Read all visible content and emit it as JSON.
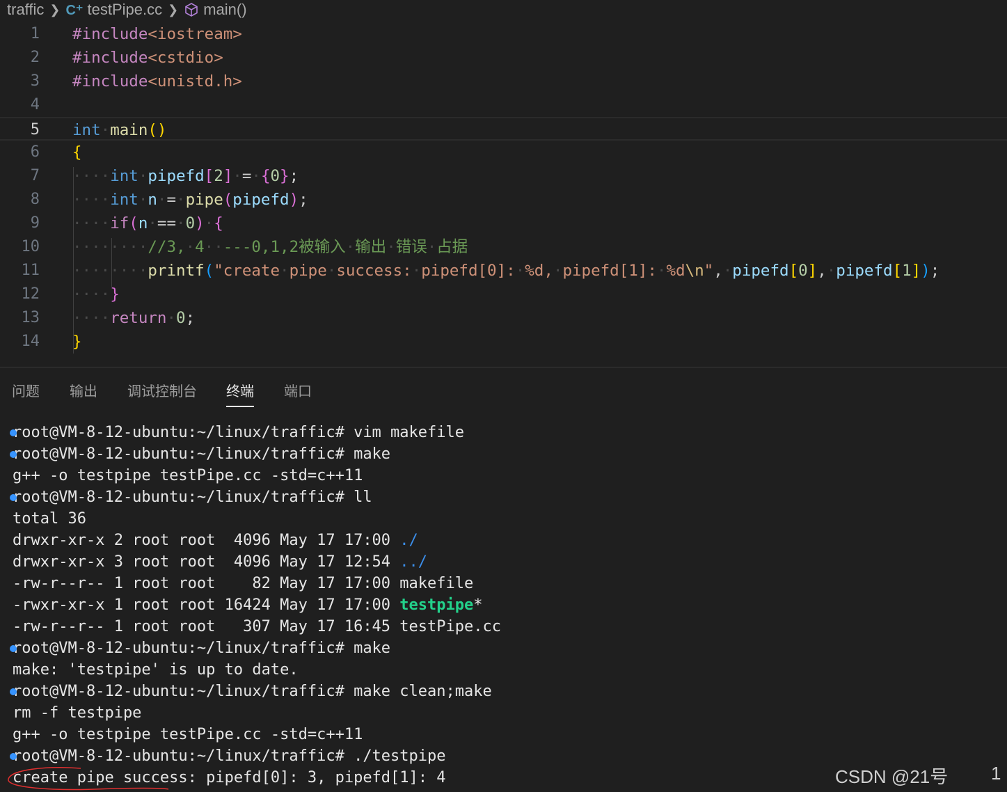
{
  "breadcrumb": {
    "folder": "traffic",
    "file": "testPipe.cc",
    "symbol": "main()",
    "file_icon": "cpp-icon",
    "symbol_icon": "cube-icon"
  },
  "editor": {
    "line_numbers": [
      "1",
      "2",
      "3",
      "4",
      "5",
      "6",
      "7",
      "8",
      "9",
      "10",
      "11",
      "12",
      "13",
      "14"
    ],
    "lines": [
      "#include<iostream>",
      "#include<cstdio>",
      "#include<unistd.h>",
      "",
      "int main()",
      "{",
      "    int pipefd[2] = {0};",
      "    int n = pipe(pipefd);",
      "    if(n == 0) {",
      "        //3, 4  ---0,1,2被输入 输出 错误 占据",
      "        printf(\"create pipe success: pipefd[0]: %d, pipefd[1]: %d\\n\", pipefd[0], pipefd[1]);",
      "    }",
      "    return 0;",
      "}"
    ]
  },
  "panel": {
    "tabs": [
      "问题",
      "输出",
      "调试控制台",
      "终端",
      "端口"
    ],
    "active_tab": "终端"
  },
  "terminal": {
    "lines": [
      "root@VM-8-12-ubuntu:~/linux/traffic# vim makefile",
      "root@VM-8-12-ubuntu:~/linux/traffic# make",
      "g++ -o testpipe testPipe.cc -std=c++11",
      "root@VM-8-12-ubuntu:~/linux/traffic# ll",
      "total 36",
      "drwxr-xr-x 2 root root  4096 May 17 17:00 ./",
      "drwxr-xr-x 3 root root  4096 May 17 12:54 ../",
      "-rw-r--r-- 1 root root    82 May 17 17:00 makefile",
      "-rwxr-xr-x 1 root root 16424 May 17 17:00 testpipe*",
      "-rw-r--r-- 1 root root   307 May 17 16:45 testPipe.cc",
      "root@VM-8-12-ubuntu:~/linux/traffic# make",
      "make: 'testpipe' is up to date.",
      "root@VM-8-12-ubuntu:~/linux/traffic# make clean;make",
      "rm -f testpipe",
      "g++ -o testpipe testPipe.cc -std=c++11",
      "root@VM-8-12-ubuntu:~/linux/traffic# ./testpipe",
      "create pipe success: pipefd[0]: 3, pipefd[1]: 4"
    ]
  },
  "watermark": "CSDN @21号",
  "edge_text": "1",
  "colors": {
    "background": "#1f1f1f",
    "keyword": "#569cd6",
    "string": "#ce9178",
    "comment": "#6a9955",
    "terminal_dir": "#3b8eea",
    "terminal_exe": "#23d18b",
    "prompt_dot": "#3794ff",
    "annotation_circle": "#e03030"
  }
}
